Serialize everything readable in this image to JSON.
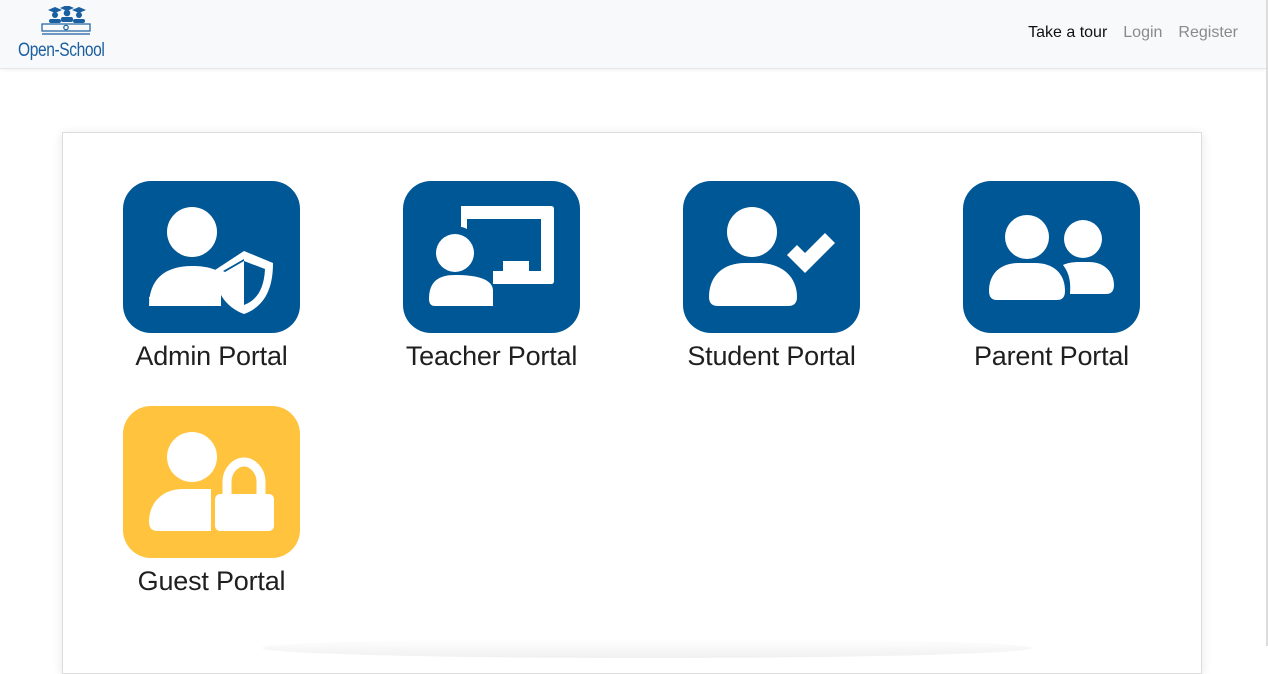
{
  "brand": {
    "name": "Open-School",
    "color": "#1a5fa0"
  },
  "nav": {
    "items": [
      {
        "label": "Take a tour",
        "active": true
      },
      {
        "label": "Login",
        "active": false
      },
      {
        "label": "Register",
        "active": false
      }
    ]
  },
  "portals": [
    {
      "label": "Admin Portal",
      "icon": "user-shield-icon",
      "color": "#005796"
    },
    {
      "label": "Teacher Portal",
      "icon": "chalkboard-teacher-icon",
      "color": "#005796"
    },
    {
      "label": "Student Portal",
      "icon": "user-check-icon",
      "color": "#005796"
    },
    {
      "label": "Parent Portal",
      "icon": "user-friends-icon",
      "color": "#005796"
    },
    {
      "label": "Guest Portal",
      "icon": "user-lock-icon",
      "color": "#ffc33d"
    }
  ]
}
